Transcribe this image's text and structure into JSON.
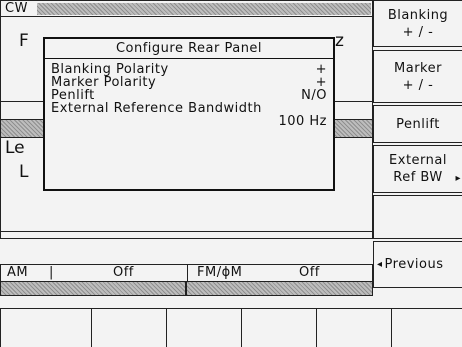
{
  "top_bar": {
    "mode": "CW"
  },
  "behind_text": {
    "f_label": "F",
    "z_label": "z",
    "le_label": "Le",
    "l_label": "L"
  },
  "status_row": {
    "am_label": "AM",
    "am_sep": "|",
    "am_value": "Off",
    "fm_label": "FM/ϕM",
    "fm_sep": "|",
    "fm_value": "Off"
  },
  "dialog": {
    "title": "Configure Rear Panel",
    "rows": [
      {
        "label": "Blanking Polarity",
        "value": "+"
      },
      {
        "label": "Marker Polarity",
        "value": "+"
      },
      {
        "label": "Penlift",
        "value": "N/O"
      },
      {
        "label": "External Reference Bandwidth",
        "value": ""
      },
      {
        "label": "",
        "value": "100 Hz"
      }
    ]
  },
  "softkeys": {
    "blanking": {
      "line1": "Blanking",
      "line2": "+ / -"
    },
    "marker": {
      "line1": "Marker",
      "line2": "+ / -"
    },
    "penlift": {
      "line1": "Penlift"
    },
    "ext_ref": {
      "line1": "External",
      "line2": "Ref BW",
      "arrow": "▸"
    },
    "previous": {
      "arrow": "◂",
      "label": "Previous"
    }
  }
}
